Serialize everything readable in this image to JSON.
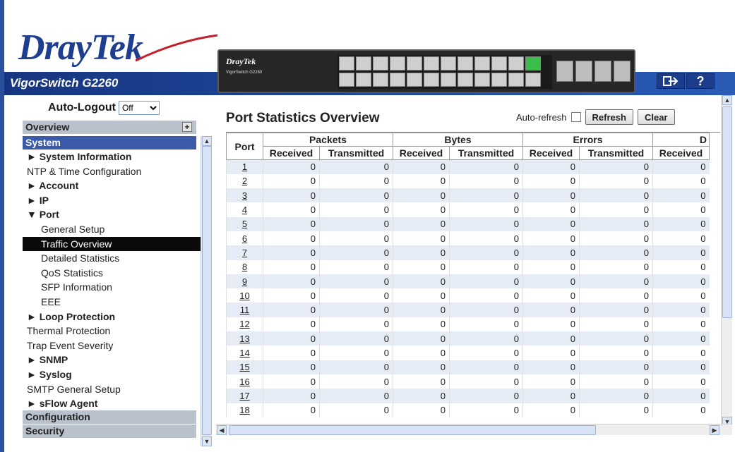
{
  "brand": {
    "logo_part1": "Dray",
    "logo_part2": "Tek",
    "model": "VigorSwitch G2260",
    "panel_brand": "DrayTek",
    "panel_model": "VigorSwitch G2260"
  },
  "header": {
    "logout_icon": "logout-arrow-icon",
    "help_icon": "help-question-icon",
    "help_glyph": "?"
  },
  "sidebar": {
    "autologout_label": "Auto-Logout",
    "autologout_value": "Off",
    "overview": "Overview",
    "system": "System",
    "configuration": "Configuration",
    "security": "Security",
    "items": [
      {
        "label": "► System Information",
        "level": "l1"
      },
      {
        "label": "NTP & Time Configuration",
        "level": "l1p"
      },
      {
        "label": "► Account",
        "level": "l1"
      },
      {
        "label": "► IP",
        "level": "l1"
      },
      {
        "label": "▼ Port",
        "level": "l1"
      },
      {
        "label": "General Setup",
        "level": "l2"
      },
      {
        "label": "Traffic Overview",
        "level": "l2",
        "active": true
      },
      {
        "label": "Detailed Statistics",
        "level": "l2"
      },
      {
        "label": "QoS Statistics",
        "level": "l2"
      },
      {
        "label": "SFP Information",
        "level": "l2"
      },
      {
        "label": "EEE",
        "level": "l2"
      },
      {
        "label": "► Loop Protection",
        "level": "l1"
      },
      {
        "label": "Thermal Protection",
        "level": "l1p"
      },
      {
        "label": "Trap Event Severity",
        "level": "l1p"
      },
      {
        "label": "► SNMP",
        "level": "l1"
      },
      {
        "label": "► Syslog",
        "level": "l1"
      },
      {
        "label": "SMTP General Setup",
        "level": "l1p"
      },
      {
        "label": "► sFlow Agent",
        "level": "l1"
      }
    ]
  },
  "main": {
    "title": "Port Statistics Overview",
    "auto_refresh_label": "Auto-refresh",
    "refresh_button": "Refresh",
    "clear_button": "Clear",
    "table": {
      "port_header": "Port",
      "groups": [
        "Packets",
        "Bytes",
        "Errors",
        "D"
      ],
      "sub_headers": [
        "Received",
        "Transmitted",
        "Received",
        "Transmitted",
        "Received",
        "Transmitted",
        "Received"
      ],
      "rows": [
        {
          "port": "1",
          "values": [
            "0",
            "0",
            "0",
            "0",
            "0",
            "0",
            "0"
          ]
        },
        {
          "port": "2",
          "values": [
            "0",
            "0",
            "0",
            "0",
            "0",
            "0",
            "0"
          ]
        },
        {
          "port": "3",
          "values": [
            "0",
            "0",
            "0",
            "0",
            "0",
            "0",
            "0"
          ]
        },
        {
          "port": "4",
          "values": [
            "0",
            "0",
            "0",
            "0",
            "0",
            "0",
            "0"
          ]
        },
        {
          "port": "5",
          "values": [
            "0",
            "0",
            "0",
            "0",
            "0",
            "0",
            "0"
          ]
        },
        {
          "port": "6",
          "values": [
            "0",
            "0",
            "0",
            "0",
            "0",
            "0",
            "0"
          ]
        },
        {
          "port": "7",
          "values": [
            "0",
            "0",
            "0",
            "0",
            "0",
            "0",
            "0"
          ]
        },
        {
          "port": "8",
          "values": [
            "0",
            "0",
            "0",
            "0",
            "0",
            "0",
            "0"
          ]
        },
        {
          "port": "9",
          "values": [
            "0",
            "0",
            "0",
            "0",
            "0",
            "0",
            "0"
          ]
        },
        {
          "port": "10",
          "values": [
            "0",
            "0",
            "0",
            "0",
            "0",
            "0",
            "0"
          ]
        },
        {
          "port": "11",
          "values": [
            "0",
            "0",
            "0",
            "0",
            "0",
            "0",
            "0"
          ]
        },
        {
          "port": "12",
          "values": [
            "0",
            "0",
            "0",
            "0",
            "0",
            "0",
            "0"
          ]
        },
        {
          "port": "13",
          "values": [
            "0",
            "0",
            "0",
            "0",
            "0",
            "0",
            "0"
          ]
        },
        {
          "port": "14",
          "values": [
            "0",
            "0",
            "0",
            "0",
            "0",
            "0",
            "0"
          ]
        },
        {
          "port": "15",
          "values": [
            "0",
            "0",
            "0",
            "0",
            "0",
            "0",
            "0"
          ]
        },
        {
          "port": "16",
          "values": [
            "0",
            "0",
            "0",
            "0",
            "0",
            "0",
            "0"
          ]
        },
        {
          "port": "17",
          "values": [
            "0",
            "0",
            "0",
            "0",
            "0",
            "0",
            "0"
          ]
        },
        {
          "port": "18",
          "values": [
            "0",
            "0",
            "0",
            "0",
            "0",
            "0",
            "0"
          ]
        }
      ]
    }
  },
  "colors": {
    "brand_blue": "#1e3f8f",
    "nav_active_bg": "#0b0b0b",
    "row_alt": "#e6ecf5"
  }
}
